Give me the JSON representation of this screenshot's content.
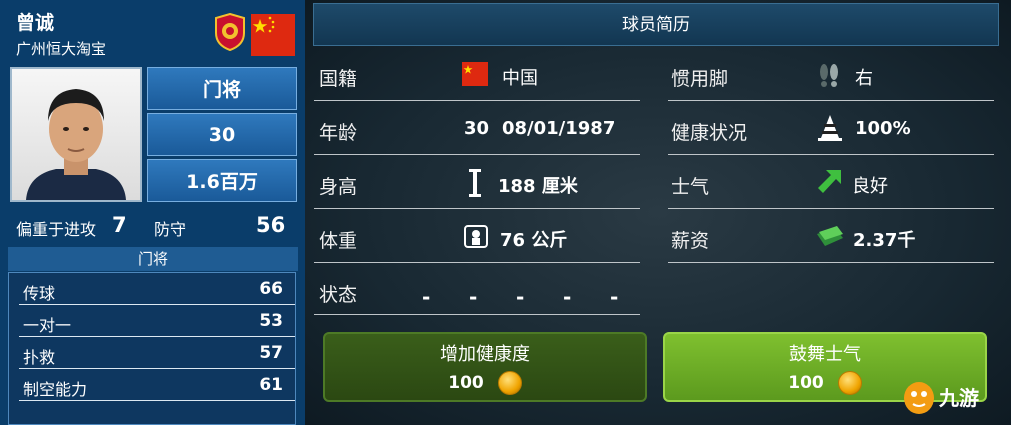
{
  "player": {
    "name": "曾诚",
    "club": "广州恒大淘宝",
    "crest_icon": "club-crest-icon",
    "flag_icon": "china-flag-icon",
    "position": "门将",
    "age": "30",
    "value": "1.6百万",
    "attack_label": "偏重于进攻",
    "attack_value": "7",
    "defense_label": "防守",
    "defense_value": "56",
    "role_label": "门将",
    "stats": [
      {
        "label": "传球",
        "value": "66"
      },
      {
        "label": "一对一",
        "value": "53"
      },
      {
        "label": "扑救",
        "value": "57"
      },
      {
        "label": "制空能力",
        "value": "61"
      }
    ]
  },
  "profile": {
    "title": "球员简历",
    "nationality_label": "国籍",
    "nationality_value": "中国",
    "age_label": "年龄",
    "age_value": "30",
    "dob_value": "08/01/1987",
    "height_label": "身高",
    "height_value": "188 厘米",
    "weight_label": "体重",
    "weight_value": "76 公斤",
    "status_label": "状态",
    "status_values": [
      "-",
      "-",
      "-",
      "-",
      "-"
    ],
    "foot_label": "惯用脚",
    "foot_value": "右",
    "health_label": "健康状况",
    "health_value": "100%",
    "morale_label": "士气",
    "morale_value": "良好",
    "salary_label": "薪资",
    "salary_value": "2.37千"
  },
  "actions": {
    "health_button_label": "增加健康度",
    "health_button_cost": "100",
    "morale_button_label": "鼓舞士气",
    "morale_button_cost": "100"
  },
  "watermark": "九游",
  "colors": {
    "accent_blue": "#0a3d6a",
    "button_green_dark": "#3a5e1a",
    "button_green_light": "#7abb2e",
    "flag_red": "#de2910",
    "arrow_green": "#3fbf3f"
  }
}
